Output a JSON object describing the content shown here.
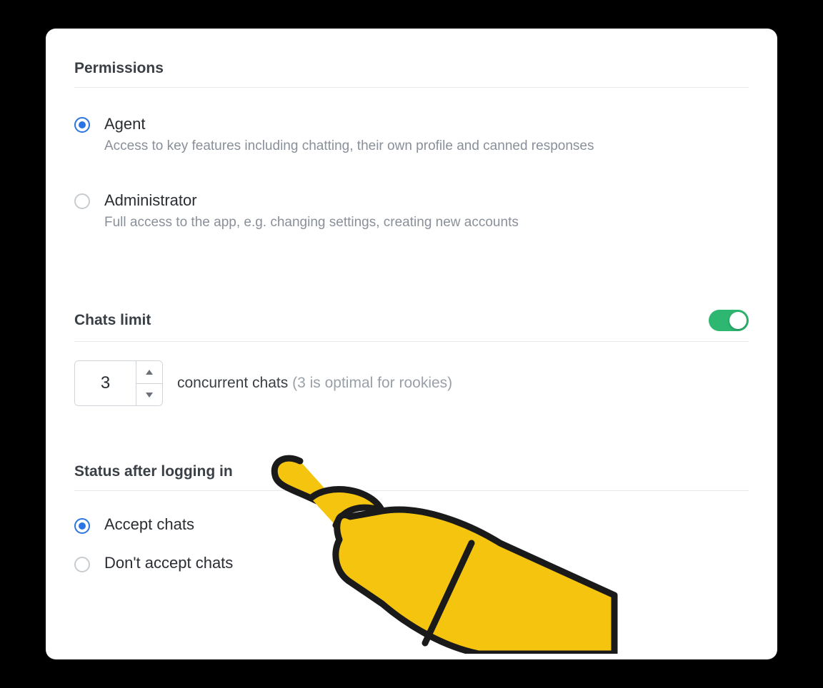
{
  "permissions": {
    "title": "Permissions",
    "options": [
      {
        "label": "Agent",
        "desc": "Access to key features including chatting, their own profile and canned responses",
        "selected": true
      },
      {
        "label": "Administrator",
        "desc": "Full access to the app, e.g. changing settings, creating new accounts",
        "selected": false
      }
    ]
  },
  "chats_limit": {
    "title": "Chats limit",
    "enabled": true,
    "value": "3",
    "label": "concurrent chats",
    "hint": "(3 is optimal for rookies)"
  },
  "status": {
    "title": "Status after logging in",
    "options": [
      {
        "label": "Accept chats",
        "selected": true
      },
      {
        "label": "Don't accept chats",
        "selected": false
      }
    ]
  }
}
